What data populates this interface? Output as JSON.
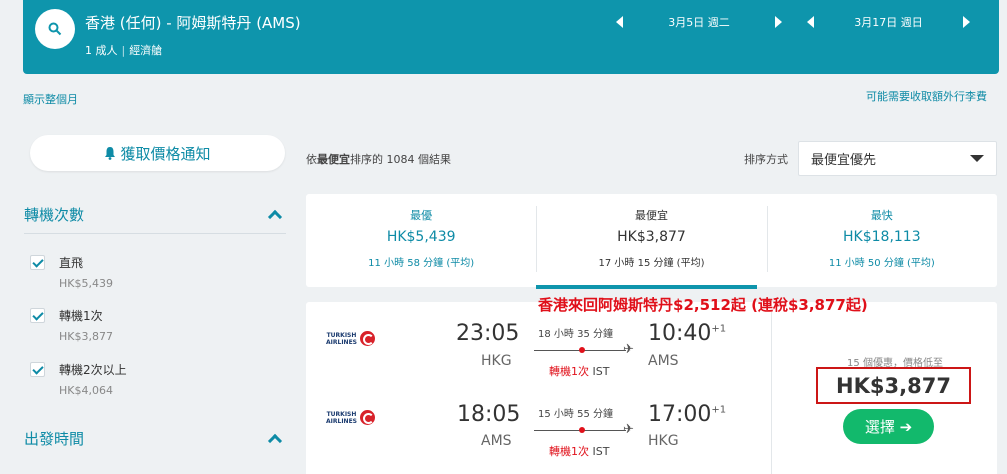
{
  "header": {
    "route": "香港 (任何) - 阿姆斯特丹 (AMS)",
    "passengers": "1 成人",
    "cabin": "經濟艙",
    "depart_date": "3月5日 週二",
    "return_date": "3月17日 週日"
  },
  "links": {
    "full_month": "顯示整個月",
    "baggage_fee": "可能需要收取額外行李費"
  },
  "sidebar": {
    "price_alert": "獲取價格通知",
    "stops_title": "轉機次數",
    "stops": [
      {
        "label": "直飛",
        "price": "HK$5,439"
      },
      {
        "label": "轉機1次",
        "price": "HK$3,877"
      },
      {
        "label": "轉機2次以上",
        "price": "HK$4,064"
      }
    ],
    "departure_title": "出發時間"
  },
  "results": {
    "count_prefix": "依",
    "count_emph": "最便宜",
    "count_suffix": "排序的 1084 個結果",
    "sort_label": "排序方式",
    "sort_value": "最便宜優先"
  },
  "tabs": [
    {
      "title": "最優",
      "price": "HK$5,439",
      "duration": "11 小時 58 分鐘 (平均)"
    },
    {
      "title": "最便宜",
      "price": "HK$3,877",
      "duration": "17 小時 15 分鐘 (平均)"
    },
    {
      "title": "最快",
      "price": "HK$18,113",
      "duration": "11 小時 50 分鐘 (平均)"
    }
  ],
  "promo": "香港來回阿姆斯特丹$2,512起 (連稅$3,877起)",
  "result": {
    "legs": [
      {
        "airline_line1": "TURKISH",
        "airline_line2": "AIRLINES",
        "dep_time": "23:05",
        "dep_code": "HKG",
        "arr_time": "10:40",
        "arr_plus": "+1",
        "arr_code": "AMS",
        "duration": "18 小時 35 分鐘",
        "stops": "轉機1次",
        "via": "IST"
      },
      {
        "airline_line1": "TURKISH",
        "airline_line2": "AIRLINES",
        "dep_time": "18:05",
        "dep_code": "AMS",
        "arr_time": "17:00",
        "arr_plus": "+1",
        "arr_code": "HKG",
        "duration": "15 小時 55 分鐘",
        "stops": "轉機1次",
        "via": "IST"
      }
    ],
    "deals": "15 個優惠，價格低至",
    "price": "HK$3,877",
    "select_label": "選擇 ➔"
  },
  "colors": {
    "teal": "#0e95ac",
    "green": "#12b96c",
    "red": "#e0101a"
  }
}
